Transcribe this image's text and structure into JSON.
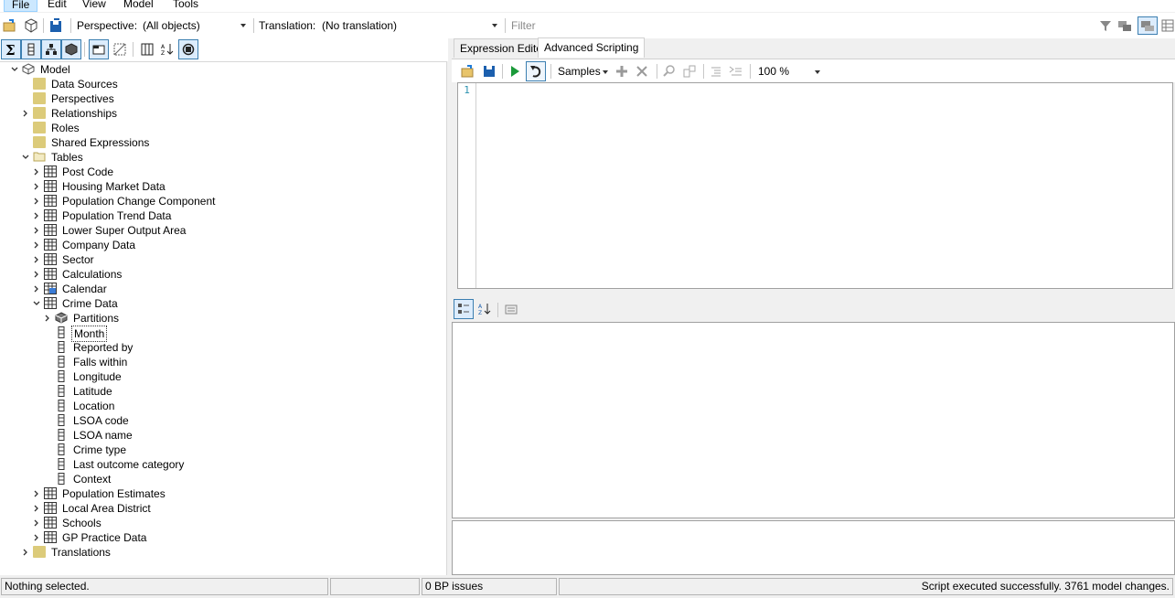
{
  "menu": {
    "file": "File",
    "edit": "Edit",
    "view": "View",
    "model": "Model",
    "tools": "Tools"
  },
  "toolbar": {
    "perspective_label": "Perspective:",
    "perspective_value": "(All objects)",
    "translation_label": "Translation:",
    "translation_value": "(No translation)",
    "filter_placeholder": "Filter"
  },
  "tree": {
    "model": "Model",
    "data_sources": "Data Sources",
    "perspectives": "Perspectives",
    "relationships": "Relationships",
    "roles": "Roles",
    "shared_expressions": "Shared Expressions",
    "tables": "Tables",
    "translations": "Translations",
    "table_items": [
      "Post Code",
      "Housing Market Data",
      "Population Change Component",
      "Population Trend Data",
      "Lower Super Output Area",
      "Company Data",
      "Sector",
      "Calculations",
      "Calendar",
      "Crime Data"
    ],
    "crime_children": {
      "partitions": "Partitions",
      "columns": [
        "Month",
        "Reported by",
        "Falls within",
        "Longitude",
        "Latitude",
        "Location",
        "LSOA code",
        "LSOA name",
        "Crime type",
        "Last outcome category",
        "Context"
      ]
    },
    "more_tables": [
      "Population Estimates",
      "Local Area District",
      "Schools",
      "GP Practice Data"
    ]
  },
  "tabs": {
    "expression_editor": "Expression Editor",
    "advanced_scripting": "Advanced Scripting"
  },
  "script_toolbar": {
    "samples": "Samples",
    "zoom": "100 %"
  },
  "editor": {
    "line_number": "1"
  },
  "status": {
    "selection": "Nothing selected.",
    "bp_issues": "0 BP issues",
    "message": "Script executed successfully. 3761 model changes."
  }
}
